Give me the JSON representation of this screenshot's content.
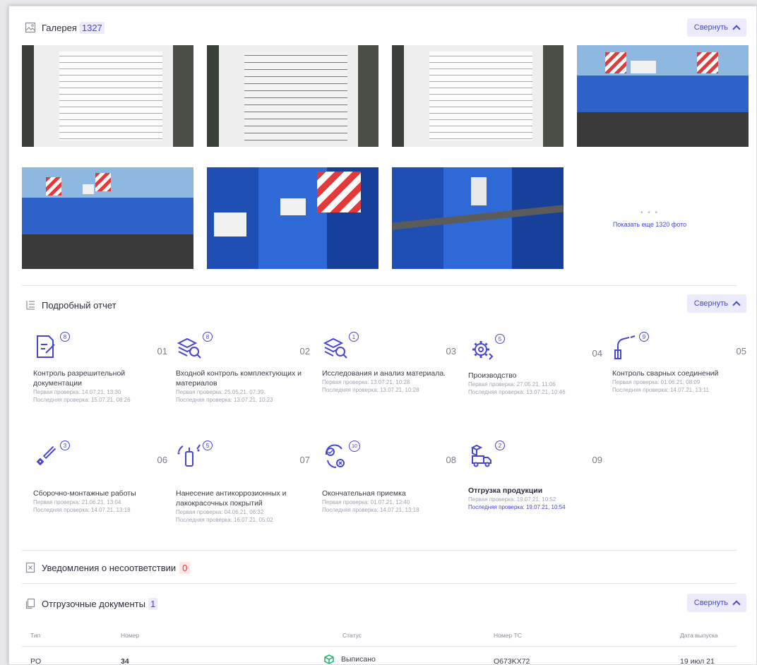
{
  "gallery": {
    "title": "Галерея",
    "count": "1327",
    "collapse_label": "Свернуть",
    "more_label": "Показать еще 1320 фото"
  },
  "report": {
    "title": "Подробный отчет",
    "collapse_label": "Свернуть",
    "steps": [
      {
        "num": "01",
        "badge": "8",
        "title": "Контроль разрешительной документации",
        "first": "Первая проверка: 14.07.21, 13:30",
        "last": "Последняя проверка: 15.07.21, 08:26"
      },
      {
        "num": "02",
        "badge": "8",
        "title": "Входной контроль комплектующих и материалов",
        "first": "Первая проверка: 25.05.21, 07:39",
        "last": "Последняя проверка: 13.07.21, 10:23"
      },
      {
        "num": "03",
        "badge": "1",
        "title": "Исследования и анализ материала.",
        "first": "Первая проверка: 13.07.21, 10:28",
        "last": "Последняя проверка: 13.07.21, 10:28"
      },
      {
        "num": "04",
        "badge": "5",
        "title": "Производство",
        "first": "Первая проверка: 27.05.21, 11:06",
        "last": "Последняя проверка: 13.07.21, 10:46"
      },
      {
        "num": "05",
        "badge": "9",
        "title": "Контроль сварных соединений",
        "first": "Первая проверка: 01.06.21, 08:09",
        "last": "Последняя проверка: 14.07.21, 13:11"
      },
      {
        "num": "06",
        "badge": "3",
        "title": "Сборочно-монтажные работы",
        "first": "Первая проверка: 21.06.21, 13:04",
        "last": "Последняя проверка: 14.07.21, 13:18"
      },
      {
        "num": "07",
        "badge": "5",
        "title": "Нанесение антикоррозионных и лакокрасочных покрытий",
        "first": "Первая проверка: 04.06.21, 06:32",
        "last": "Последняя проверка: 16.07.21, 05:02"
      },
      {
        "num": "08",
        "badge": "10",
        "title": "Окончательная приемка",
        "first": "Первая проверка: 01.07.21, 12:40",
        "last": "Последняя проверка: 14.07.21, 13:18"
      },
      {
        "num": "09",
        "badge": "2",
        "title": "Отгрузка продукции",
        "first": "Первая проверка: 19.07.21, 10:52",
        "last": "Последняя проверка: 19.07.21, 10:54"
      }
    ]
  },
  "notices": {
    "title": "Уведомления о несоответствии",
    "count": "0"
  },
  "shipping": {
    "title": "Отгрузочные документы",
    "count": "1",
    "collapse_label": "Свернуть",
    "columns": [
      "Тип",
      "Номер",
      "Статус",
      "Номер ТС",
      "Дата выпуска"
    ],
    "row": {
      "type": "PO",
      "number": "34",
      "status": "Выписано",
      "vehicle": "O673KX72",
      "date": "19 июл 21"
    }
  },
  "colors": {
    "accent": "#4646d6",
    "danger": "#e23a3a",
    "success": "#2bb673"
  }
}
